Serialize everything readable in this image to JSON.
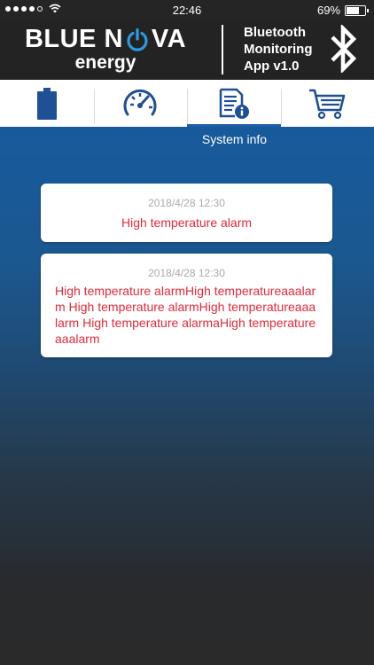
{
  "status_bar": {
    "time": "22:46",
    "battery_percent": "69%",
    "battery_level": 0.69
  },
  "header": {
    "brand_left": "BLUE N",
    "brand_right": "VA",
    "brand_sub": "energy",
    "app_title_line1": "Bluetooth",
    "app_title_line2": "Monitoring",
    "app_title_line3": "App v1.0"
  },
  "tabs": [
    {
      "icon": "battery-icon"
    },
    {
      "icon": "speedometer-icon"
    },
    {
      "icon": "document-info-icon",
      "label": "System info",
      "active": true
    },
    {
      "icon": "shopping-cart-icon"
    }
  ],
  "colors": {
    "brand_blue": "#1f5fa6",
    "alarm_red": "#e02a3a"
  },
  "alarms": [
    {
      "time": "2018/4/28  12:30",
      "message": "High temperature alarm"
    },
    {
      "time": "2018/4/28  12:30",
      "message": "High temperature alarmHigh temperatureaaalarm  High temperature alarmHigh temperatureaaalarm High temperature alarmaHigh temperatureaaalarm"
    }
  ]
}
